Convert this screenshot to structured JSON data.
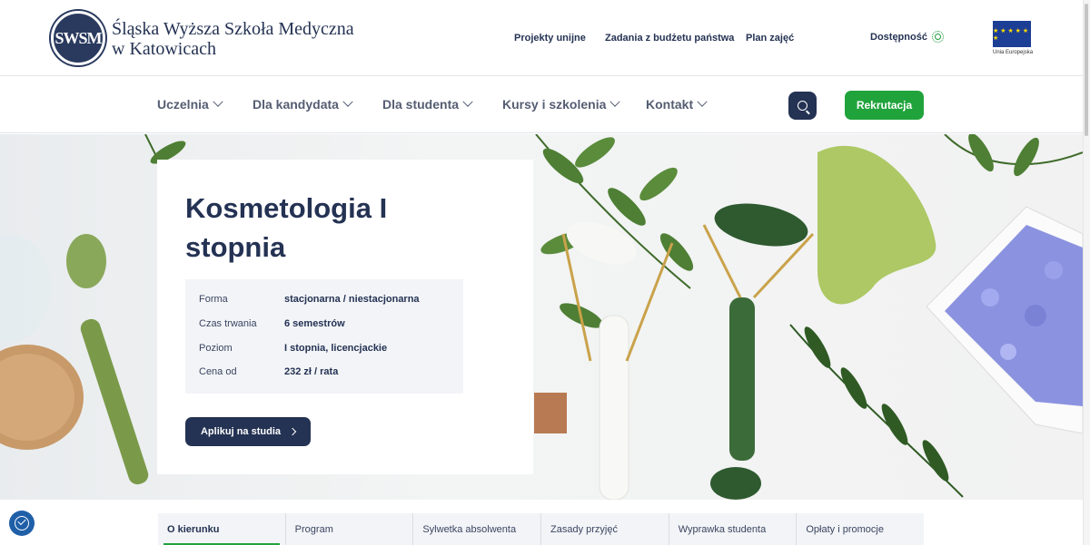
{
  "brand": {
    "seal_text": "SWSM",
    "name_line1": "Śląska Wyższa Szkoła Medyczna",
    "name_line2": "w Katowicach"
  },
  "top_links": [
    "Projekty unijne",
    "Zadania z budżetu państwa",
    "Plan zajęć"
  ],
  "accessibility_label": "Dostępność",
  "eu": {
    "label": "Unia Europejska",
    "stars": "★ ★ ★ ★ ★ ★"
  },
  "nav": {
    "items": [
      "Uczelnia",
      "Dla kandydata",
      "Dla studenta",
      "Kursy i szkolenia",
      "Kontakt"
    ],
    "recruit_label": "Rekrutacja"
  },
  "hero": {
    "title": "Kosmetologia I stopnia",
    "info": [
      {
        "label": "Forma",
        "value": "stacjonarna / niestacjonarna"
      },
      {
        "label": "Czas trwania",
        "value": "6 semestrów"
      },
      {
        "label": "Poziom",
        "value": "I stopnia, licencjackie"
      },
      {
        "label": "Cena od",
        "value": "232 zł / rata"
      }
    ],
    "apply_label": "Aplikuj na studia"
  },
  "tabs": [
    "O kierunku",
    "Program",
    "Sylwetka absolwenta",
    "Zasady przyjęć",
    "Wyprawka studenta",
    "Opłaty i promocje"
  ],
  "colors": {
    "navy": "#243253",
    "green": "#21a33c",
    "eu_blue": "#1c3e95"
  }
}
